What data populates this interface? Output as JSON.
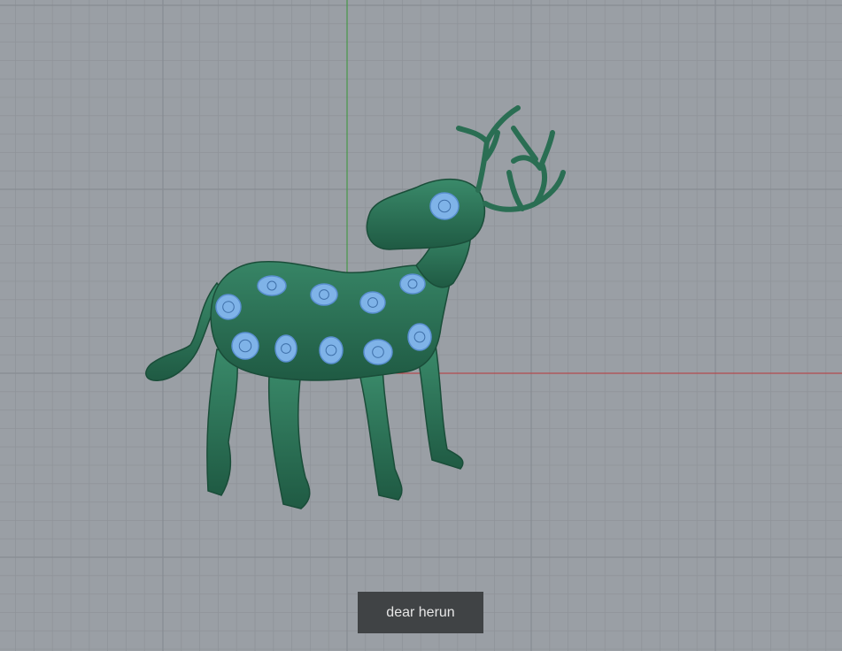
{
  "viewport": {
    "background_color": "#9a9fa5",
    "grid_minor_color": "#8f949a",
    "grid_major_color": "#878c92",
    "x_axis_color": "#c0393b",
    "y_axis_color": "#3a9a3a"
  },
  "model": {
    "body_color": "#2f7a5c",
    "body_shade_color": "#1f5a43",
    "spot_color": "#7fb3e8",
    "spot_ring_color": "#5a8fd0"
  },
  "selection_label": {
    "text": "dear herun"
  }
}
